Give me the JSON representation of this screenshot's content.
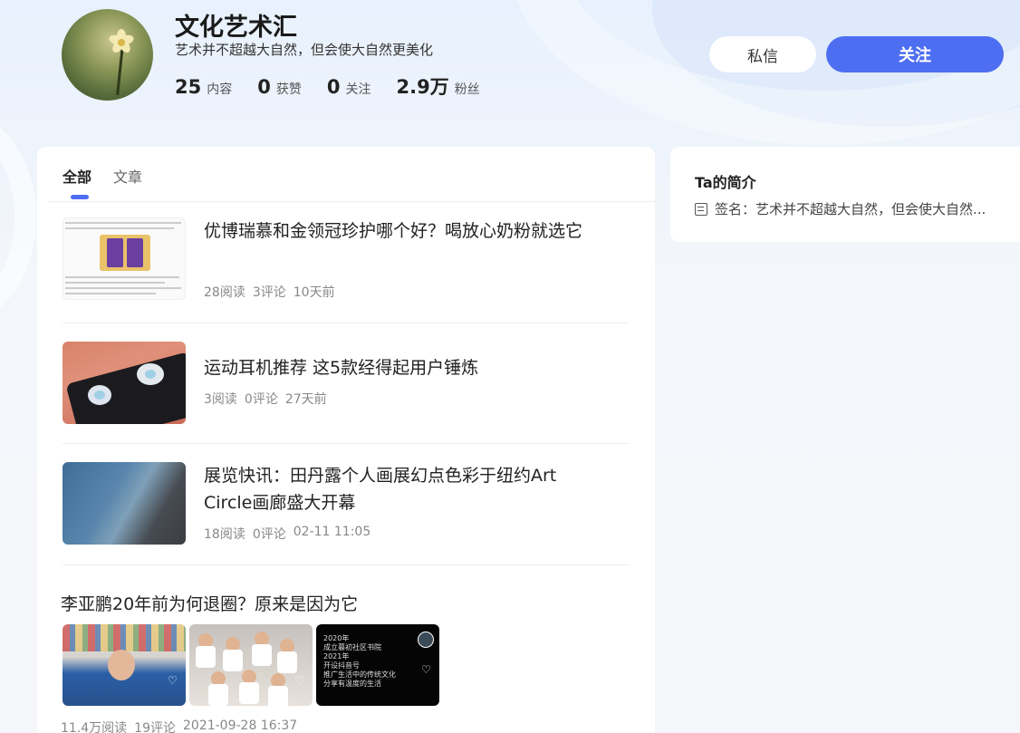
{
  "profile": {
    "name": "文化艺术汇",
    "signature": "艺术并不超越大自然，但会使大自然更美化",
    "stats": [
      {
        "num": "25",
        "label": "内容"
      },
      {
        "num": "0",
        "label": "获赞"
      },
      {
        "num": "0",
        "label": "关注"
      },
      {
        "num": "2.9万",
        "label": "粉丝"
      }
    ],
    "message_label": "私信",
    "follow_label": "关注"
  },
  "tabs": [
    {
      "label": "全部",
      "active": true
    },
    {
      "label": "文章",
      "active": false
    }
  ],
  "articles": [
    {
      "title": "优博瑞慕和金领冠珍护哪个好？喝放心奶粉就选它",
      "reads": "28阅读",
      "comments": "3评论",
      "time": "10天前"
    },
    {
      "title": "运动耳机推荐 这5款经得起用户锤炼",
      "reads": "3阅读",
      "comments": "0评论",
      "time": "27天前"
    },
    {
      "title": "展览快讯：田丹露个人画展幻点色彩于纽约Art Circle画廊盛大开幕",
      "reads": "18阅读",
      "comments": "0评论",
      "time": "02-11 11:05"
    }
  ],
  "video_post": {
    "title": "李亚鹏20年前为何退圈？原来是因为它",
    "reads": "11.4万阅读",
    "comments": "19评论",
    "time": "2021-09-28 16:37",
    "frame3_lines": [
      "2020年",
      "成立暮初社区书院",
      "2021年",
      "开设抖音号",
      "推广生活中的传统文化",
      "分享有温度的生活"
    ]
  },
  "sidebar": {
    "title": "Ta的简介",
    "signature": "签名：艺术并不超越大自然，但会使大自然..."
  },
  "colors": {
    "accent": "#4e6ef2",
    "background": "#f4f6f9"
  }
}
